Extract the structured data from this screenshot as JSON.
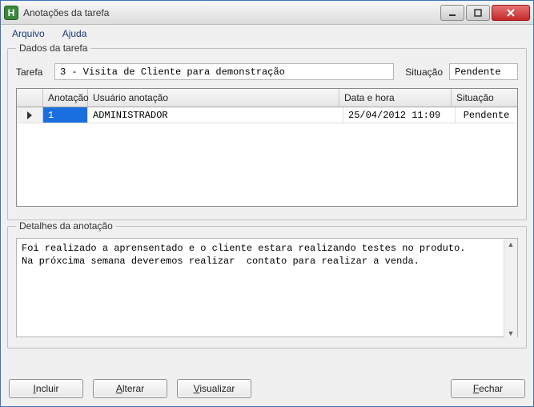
{
  "window": {
    "title": "Anotações da tarefa",
    "icon_letter": "H"
  },
  "menu": {
    "file": "Arquivo",
    "help": "Ajuda"
  },
  "task_group": {
    "legend": "Dados da tarefa",
    "task_label": "Tarefa",
    "task_value": "3 - Visita de Cliente para demonstração",
    "status_label": "Situação",
    "status_value": "Pendente"
  },
  "grid": {
    "headers": {
      "annotation": "Anotação",
      "user": "Usuário anotação",
      "datetime": "Data e hora",
      "status": "Situação"
    },
    "rows": [
      {
        "annotation": "1",
        "user": "ADMINISTRADOR",
        "datetime": "25/04/2012 11:09",
        "status": "Pendente"
      }
    ]
  },
  "details": {
    "legend": "Detalhes da anotação",
    "text": "Foi realizado a aprensentado e o cliente estara realizando testes no produto.\nNa próxcima semana deveremos realizar  contato para realizar a venda."
  },
  "buttons": {
    "include": "Incluir",
    "edit": "Alterar",
    "view": "Visualizar",
    "close": "Fechar"
  }
}
